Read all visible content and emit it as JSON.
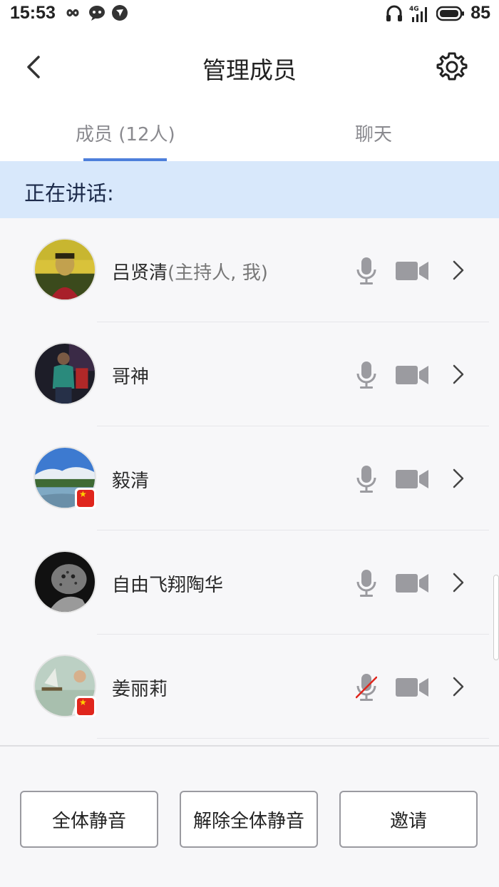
{
  "status_bar": {
    "time": "15:53",
    "network": "4G",
    "battery": "85"
  },
  "header": {
    "title": "管理成员",
    "back_icon": "back-chevron-icon",
    "settings_icon": "gear-icon"
  },
  "tabs": [
    {
      "label": "成员 (12人)",
      "active": true
    },
    {
      "label": "聊天",
      "active": false
    }
  ],
  "speaking_label": "正在讲话:",
  "members": [
    {
      "name": "吕贤清",
      "role": "(主持人, 我)",
      "mic": "on",
      "camera": "on",
      "flag": false
    },
    {
      "name": "哥神",
      "role": "",
      "mic": "on",
      "camera": "on",
      "flag": false
    },
    {
      "name": "毅清",
      "role": "",
      "mic": "on",
      "camera": "on",
      "flag": true
    },
    {
      "name": "自由飞翔陶华",
      "role": "",
      "mic": "on",
      "camera": "on",
      "flag": false
    },
    {
      "name": "姜丽莉",
      "role": "",
      "mic": "muted",
      "camera": "on",
      "flag": true
    }
  ],
  "actions": {
    "mute_all": "全体静音",
    "unmute_all": "解除全体静音",
    "invite": "邀请"
  },
  "colors": {
    "accent": "#4d7fdb",
    "speaking_bg": "#d8e8fb",
    "muted_slash": "#e0261d",
    "icon_gray": "#9b9ba0"
  }
}
